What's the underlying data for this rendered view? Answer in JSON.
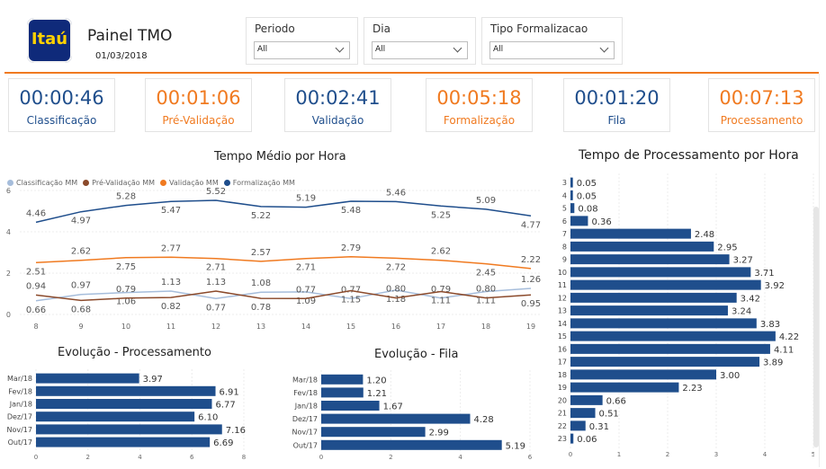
{
  "header": {
    "logo_text": "Itaú",
    "title": "Painel TMO",
    "date": "01/03/2018"
  },
  "filters": [
    {
      "label": "Periodo",
      "value": "All"
    },
    {
      "label": "Dia",
      "value": "All"
    },
    {
      "label": "Tipo Formalizacao",
      "value": "All"
    }
  ],
  "kpis": [
    {
      "value": "00:00:46",
      "label": "Classificação",
      "color": "#1f4e8c"
    },
    {
      "value": "00:01:06",
      "label": "Pré-Validação",
      "color": "#f07a20"
    },
    {
      "value": "00:02:41",
      "label": "Validação",
      "color": "#1f4e8c"
    },
    {
      "value": "00:05:18",
      "label": "Formalização",
      "color": "#f07a20"
    },
    {
      "value": "00:01:20",
      "label": "Fila",
      "color": "#1f4e8c"
    },
    {
      "value": "00:07:13",
      "label": "Processamento",
      "color": "#f07a20"
    }
  ],
  "chart_data": [
    {
      "type": "line",
      "title": "Tempo Médio por Hora",
      "x": [
        8,
        9,
        10,
        11,
        12,
        13,
        14,
        15,
        16,
        17,
        18,
        19
      ],
      "ylim": [
        0,
        6
      ],
      "yticks": [
        0,
        2,
        4,
        6
      ],
      "legend_position": "top-left",
      "series": [
        {
          "name": "Classificação MM",
          "color": "#a6bddb",
          "values": [
            0.66,
            0.97,
            1.06,
            1.13,
            0.77,
            1.08,
            1.09,
            0.77,
            1.18,
            0.79,
            1.11,
            1.26
          ]
        },
        {
          "name": "Pré-Validação MM",
          "color": "#8b4a2b",
          "values": [
            0.94,
            0.68,
            0.79,
            0.82,
            1.13,
            0.78,
            0.77,
            1.15,
            0.8,
            1.11,
            0.8,
            0.95
          ]
        },
        {
          "name": "Validação MM",
          "color": "#f07a20",
          "values": [
            2.51,
            2.62,
            2.75,
            2.77,
            2.71,
            2.57,
            2.71,
            2.79,
            2.72,
            2.62,
            2.45,
            2.22
          ]
        },
        {
          "name": "Formalização MM",
          "color": "#1f4e8c",
          "values": [
            4.46,
            4.97,
            5.28,
            5.47,
            5.52,
            5.22,
            5.19,
            5.48,
            5.46,
            5.25,
            5.09,
            4.77
          ]
        }
      ]
    },
    {
      "type": "bar",
      "orientation": "horizontal",
      "title": "Tempo de Processamento por Hora",
      "categories": [
        "3",
        "4",
        "5",
        "6",
        "7",
        "8",
        "9",
        "10",
        "11",
        "12",
        "13",
        "14",
        "15",
        "16",
        "17",
        "18",
        "19",
        "20",
        "21",
        "22",
        "23"
      ],
      "values": [
        0.05,
        0.05,
        0.08,
        0.36,
        2.48,
        2.95,
        3.27,
        3.71,
        3.92,
        3.42,
        3.24,
        3.83,
        4.22,
        4.11,
        3.89,
        3.0,
        2.23,
        0.66,
        0.51,
        0.31,
        0.06
      ],
      "labels": [
        "0.05",
        "0.05",
        "0.08",
        "0.36",
        "2.48",
        "2.95",
        "3.27",
        "3.71",
        "3.92",
        "3.42",
        "3.24",
        "3.83",
        "4.22",
        "4.11",
        "3.89",
        "3.00",
        "2.23",
        "0.66",
        "0.51",
        "0.31",
        "0.06"
      ],
      "xlim": [
        0,
        5
      ],
      "xticks": [
        0,
        1,
        2,
        3,
        4,
        5
      ],
      "color": "#1f4e8c"
    },
    {
      "type": "bar",
      "orientation": "horizontal",
      "title": "Evolução - Processamento",
      "categories": [
        "Mar/18",
        "Fev/18",
        "Jan/18",
        "Dez/17",
        "Nov/17",
        "Out/17"
      ],
      "values": [
        3.97,
        6.91,
        6.77,
        6.1,
        7.16,
        6.69
      ],
      "labels": [
        "3.97",
        "6.91",
        "6.77",
        "6.10",
        "7.16",
        "6.69"
      ],
      "xlim": [
        0,
        8
      ],
      "xticks": [
        0,
        2,
        4,
        6,
        8
      ],
      "color": "#1f4e8c"
    },
    {
      "type": "bar",
      "orientation": "horizontal",
      "title": "Evolução - Fila",
      "categories": [
        "Mar/18",
        "Fev/18",
        "Jan/18",
        "Dez/17",
        "Nov/17",
        "Out/17"
      ],
      "values": [
        1.2,
        1.21,
        1.67,
        4.28,
        2.99,
        5.19
      ],
      "labels": [
        "1.20",
        "1.21",
        "1.67",
        "4.28",
        "2.99",
        "5.19"
      ],
      "xlim": [
        0,
        6
      ],
      "xticks": [
        0,
        2,
        4,
        6
      ],
      "color": "#1f4e8c"
    }
  ]
}
